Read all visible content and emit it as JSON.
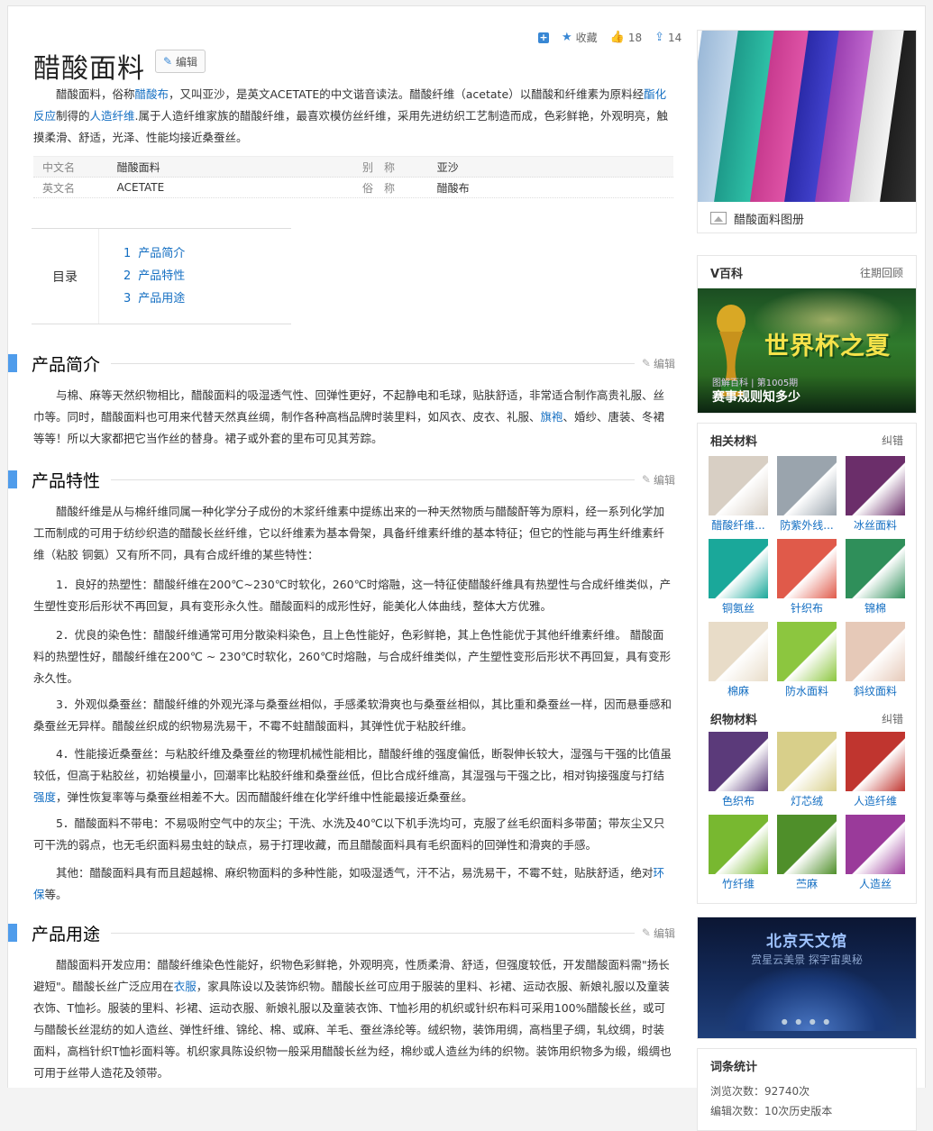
{
  "actions": {
    "add_label": "+",
    "collect_label": "收藏",
    "like_count": "18",
    "share_count": "14"
  },
  "title": "醋酸面料",
  "edit_label": "编辑",
  "summary": {
    "p1": "醋酸面料，俗称",
    "link1": "醋酸布",
    "p2": "，又叫亚沙，是英文ACETATE的中文谐音读法。醋酸纤维（acetate）以醋酸和纤维素为原料经",
    "link2": "酯化反应",
    "p3": "制得的",
    "link3": "人造纤维",
    "p4": ".属于人造纤维家族的醋酸纤维，最喜欢模仿丝纤维，采用先进纺织工艺制造而成，色彩鲜艳，外观明亮，触摸柔滑、舒适，光泽、性能均接近桑蚕丝。"
  },
  "basic_info": [
    {
      "k1": "中文名",
      "v1": "醋酸面料",
      "k2": "别　称",
      "v2": "亚沙"
    },
    {
      "k1": "英文名",
      "v1": "ACETATE",
      "k2": "俗　称",
      "v2": "醋酸布"
    }
  ],
  "toc": {
    "label": "目录",
    "items": [
      {
        "num": "1",
        "label": "产品简介"
      },
      {
        "num": "2",
        "label": "产品特性"
      },
      {
        "num": "3",
        "label": "产品用途"
      }
    ]
  },
  "sections": {
    "intro": {
      "title": "产品简介",
      "edit": "编辑",
      "p_a": "与棉、麻等天然织物相比，醋酸面料的吸湿透气性、回弹性更好，不起静电和毛球，贴肤舒适，非常适合制作高贵礼服、丝巾等。同时，醋酸面料也可用来代替天然真丝绸，制作各种高档品牌时装里料，如风衣、皮衣、礼服、",
      "link": "旗袍",
      "p_b": "、婚纱、唐装、冬裙等等！所以大家都把它当作丝的替身。裙子或外套的里布可见其芳踪。"
    },
    "features": {
      "title": "产品特性",
      "edit": "编辑",
      "p0": "醋酸纤维是从与棉纤维同属一种化学分子成份的木浆纤维素中提练出来的一种天然物质与醋酸酐等为原料，经一系列化学加工而制成的可用于纺纱织造的醋酸长丝纤维，它以纤维素为基本骨架，具备纤维素纤维的基本特征；但它的性能与再生纤维素纤维（粘胶 铜氨）又有所不同，具有合成纤维的某些特性：",
      "p1": "1．良好的热塑性：醋酸纤维在200℃~230℃时软化，260℃时熔融，这一特征使醋酸纤维具有热塑性与合成纤维类似，产生塑性变形后形状不再回复，具有变形永久性。醋酸面料的成形性好，能美化人体曲线，整体大方优雅。",
      "p2": "2．优良的染色性：醋酸纤维通常可用分散染料染色，且上色性能好，色彩鲜艳，其上色性能优于其他纤维素纤维。 醋酸面料的热塑性好，醋酸纤维在200℃ ~ 230℃时软化，260℃时熔融，与合成纤维类似，产生塑性变形后形状不再回复，具有变形永久性。",
      "p3": "3．外观似桑蚕丝：醋酸纤维的外观光泽与桑蚕丝相似，手感柔软滑爽也与桑蚕丝相似，其比重和桑蚕丝一样，因而悬垂感和桑蚕丝无异样。醋酸丝织成的织物易洗易干，不霉不蛀醋酸面料，其弹性优于粘胶纤维。",
      "p4a": "4．性能接近桑蚕丝：与粘胶纤维及桑蚕丝的物理机械性能相比，醋酸纤维的强度偏低，断裂伸长较大，湿强与干强的比值虽较低，但高于粘胶丝，初始模量小，回潮率比粘胶纤维和桑蚕丝低，但比合成纤维高，其湿强与干强之比，相对钩接强度与打结",
      "p4link": "强度",
      "p4b": "，弹性恢复率等与桑蚕丝相差不大。因而醋酸纤维在化学纤维中性能最接近桑蚕丝。",
      "p5": "5．醋酸面料不带电：不易吸附空气中的灰尘；干洗、水洗及40℃以下机手洗均可，克服了丝毛织面料多带菌；带灰尘又只可干洗的弱点，也无毛织面料易虫蛀的缺点，易于打理收藏，而且醋酸面料具有毛织面料的回弹性和滑爽的手感。",
      "p6a": "其他：醋酸面料具有而且超越棉、麻织物面料的多种性能，如吸湿透气，汗不沾，易洗易干，不霉不蛀，贴肤舒适，绝对",
      "p6link": "环保",
      "p6b": "等。"
    },
    "uses": {
      "title": "产品用途",
      "edit": "编辑",
      "pa": "醋酸面料开发应用：醋酸纤维染色性能好，织物色彩鲜艳，外观明亮，性质柔滑、舒适，但强度较低，开发醋酸面料需\"扬长避短\"。醋酸长丝广泛应用在",
      "link": "衣服",
      "pb": "，家具陈设以及装饰织物。醋酸长丝可应用于服装的里料、衫裙、运动衣服、新娘礼服以及童装衣饰、T恤衫。服装的里料、衫裙、运动衣服、新娘礼服以及童装衣饰、T恤衫用的机织或针织布料可采用100%醋酸长丝，或可与醋酸长丝混纺的如人造丝、弹性纤维、锦纶、棉、或麻、羊毛、蚕丝涤纶等。绒织物，装饰用绸，高档里子绸，轧纹绸，时装面料，高档针织T恤衫面料等。机织家具陈设织物一般采用醋酸长丝为经，棉纱或人造丝为纬的织物。装饰用织物多为缎，缎绸也可用于丝带人造花及领带。"
    }
  },
  "sidebar": {
    "album_caption": "醋酸面料图册",
    "vbaike": {
      "title": "V百科",
      "more": "往期回顾",
      "banner_title": "世界杯之夏",
      "banner_sub": "图解百科 | 第1005期",
      "banner_sub2": "赛事规则知多少"
    },
    "related": {
      "title": "相关材料",
      "action": "纠错",
      "items": [
        {
          "label": "醋酸纤维...",
          "color": "#d8cfc4"
        },
        {
          "label": "防紫外线...",
          "color": "#9aa4ad"
        },
        {
          "label": "冰丝面料",
          "color": "#6b2e6a"
        },
        {
          "label": "铜氨丝",
          "color": "#1aa89a"
        },
        {
          "label": "针织布",
          "color": "#e05a4a"
        },
        {
          "label": "锦棉",
          "color": "#2f8f5a"
        },
        {
          "label": "棉麻",
          "color": "#e8dcc8"
        },
        {
          "label": "防水面料",
          "color": "#8cc63f"
        },
        {
          "label": "斜纹面料",
          "color": "#e6c9b8"
        }
      ]
    },
    "fabric": {
      "title": "织物材料",
      "action": "纠错",
      "items": [
        {
          "label": "色织布",
          "color": "#5b3a7a"
        },
        {
          "label": "灯芯绒",
          "color": "#d8cf8a"
        },
        {
          "label": "人造纤维",
          "color": "#c0352f"
        },
        {
          "label": "竹纤维",
          "color": "#78b830"
        },
        {
          "label": "苎麻",
          "color": "#4f8f2a"
        },
        {
          "label": "人造丝",
          "color": "#9a3a9a"
        }
      ]
    },
    "planet": {
      "title": "北京天文馆",
      "subtitle": "赏星云美景  探宇宙奥秘",
      "dots": "● ● ● ●"
    },
    "stats": {
      "title": "词条统计",
      "views": "浏览次数：92740次",
      "edits": "编辑次数：10次历史版本"
    }
  }
}
